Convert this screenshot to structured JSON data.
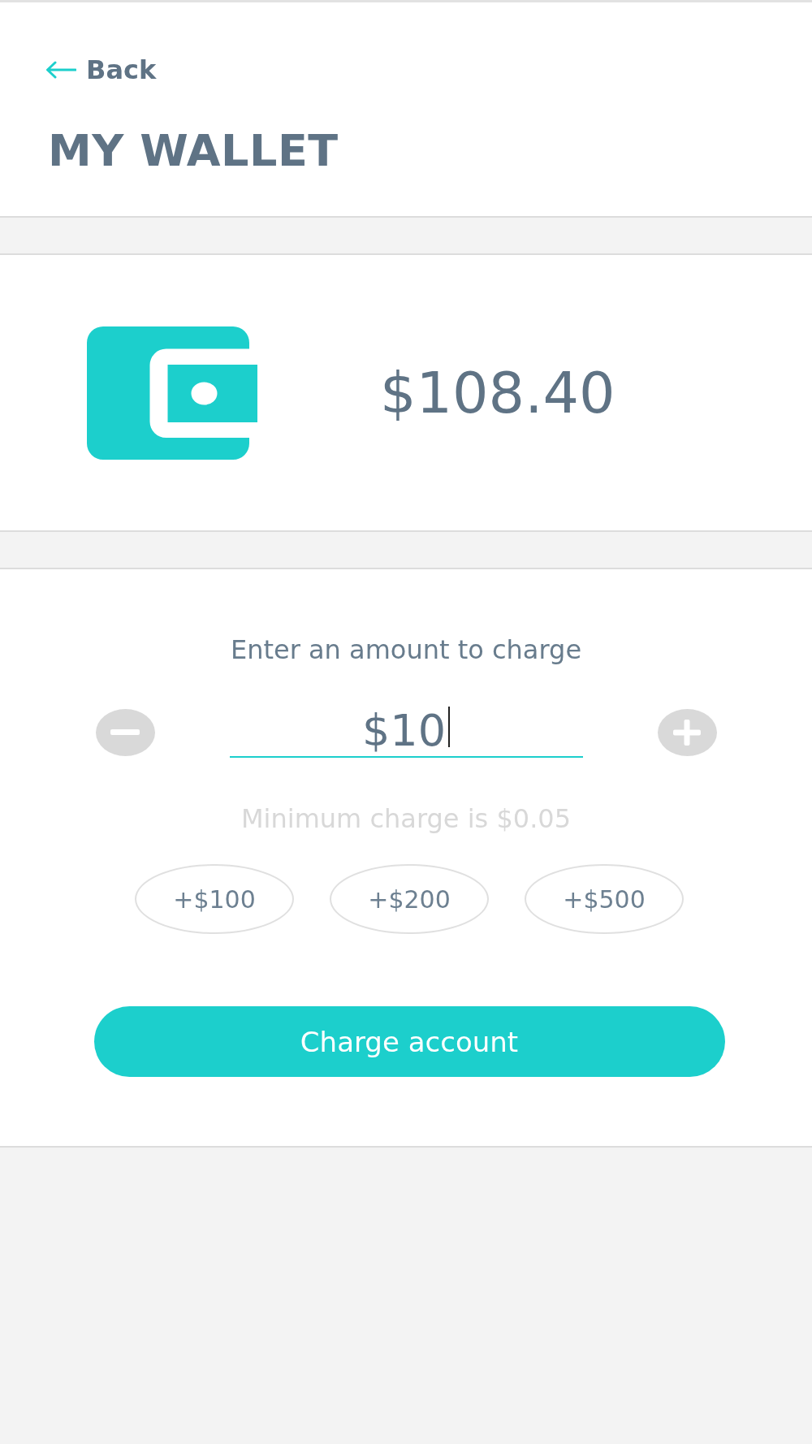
{
  "header": {
    "back_link": {
      "label": "Back"
    },
    "title": "MY WALLET"
  },
  "wallet": {
    "balance": "$108.40"
  },
  "charge": {
    "prompt": "Enter an amount to charge",
    "amount_field": {
      "value": "$10",
      "focused": true
    },
    "hint": "Minimum charge is $0.05",
    "quick_amounts": [
      "+$100",
      "+$200",
      "+$500"
    ],
    "submit_button": {
      "label": "Charge account"
    }
  }
}
